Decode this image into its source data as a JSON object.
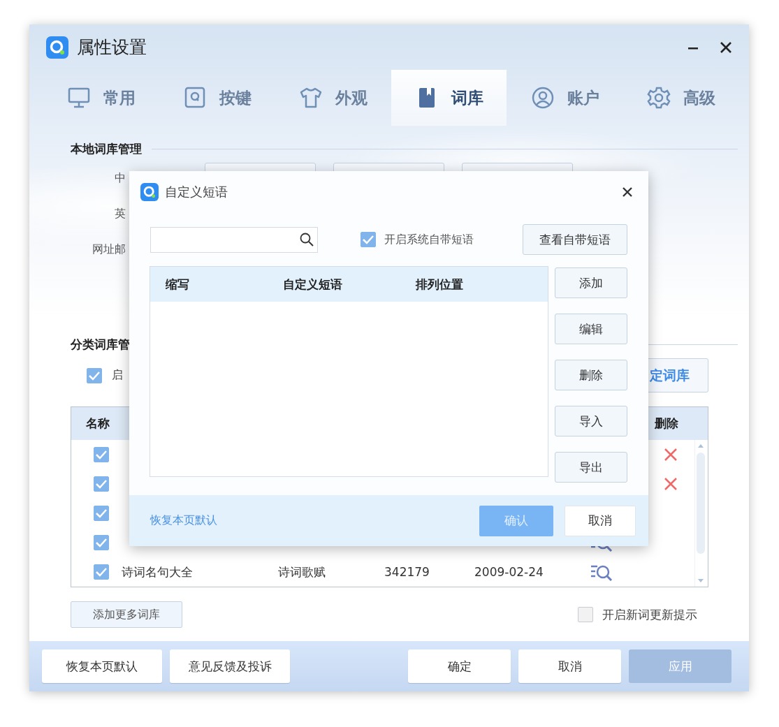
{
  "window": {
    "title": "属性设置"
  },
  "tabs": [
    {
      "label": "常用",
      "selected": false
    },
    {
      "label": "按键",
      "selected": false
    },
    {
      "label": "外观",
      "selected": false
    },
    {
      "label": "词库",
      "selected": true
    },
    {
      "label": "账户",
      "selected": false
    },
    {
      "label": "高级",
      "selected": false
    }
  ],
  "local_library": {
    "heading": "本地词库管理",
    "rows": [
      {
        "label": "中"
      },
      {
        "label": "英"
      },
      {
        "label": "网址邮"
      }
    ]
  },
  "category_library": {
    "heading": "分类词库管",
    "enable": {
      "label": "启",
      "checked": true
    },
    "custom_button": "定词库",
    "table": {
      "name_header": "名称",
      "delete_header": "删除",
      "rows": [
        {
          "checked": true,
          "deletable": true
        },
        {
          "checked": true,
          "deletable": true
        },
        {
          "checked": true,
          "deletable": false
        },
        {
          "checked": true,
          "deletable": false
        },
        {
          "checked": true,
          "name": "诗词名句大全",
          "category": "诗词歌赋",
          "count": "342179",
          "date": "2009-02-24",
          "deletable": false
        }
      ]
    },
    "add_button": "添加更多词库",
    "update_hint": {
      "label": "开启新词更新提示",
      "checked": false
    }
  },
  "footer": {
    "left_buttons": [
      {
        "label": "恢复本页默认",
        "disabled": false
      },
      {
        "label": "意见反馈及投诉",
        "disabled": false
      }
    ],
    "right_buttons": [
      {
        "label": "确定",
        "disabled": false
      },
      {
        "label": "取消",
        "disabled": false
      },
      {
        "label": "应用",
        "disabled": true
      }
    ]
  },
  "dialog": {
    "title": "自定义短语",
    "system_phrases": {
      "label": "开启系统自带短语",
      "checked": true
    },
    "view_button": "查看自带短语",
    "columns": [
      "缩写",
      "自定义短语",
      "排列位置"
    ],
    "side_buttons": [
      "添加",
      "编辑",
      "删除",
      "导入",
      "导出"
    ],
    "reset_link": "恢复本页默认",
    "confirm": {
      "label": "确认",
      "disabled": true
    },
    "cancel": "取消"
  }
}
